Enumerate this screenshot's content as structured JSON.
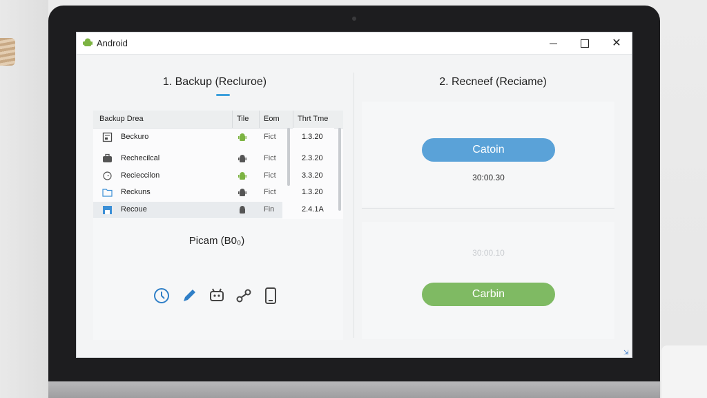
{
  "window": {
    "title": "Android",
    "app_icon": "android-icon",
    "accent": "#3ea0dc"
  },
  "left": {
    "heading": "1. Backup (Recluroe)",
    "table": {
      "columns": [
        "Backup Drea",
        "Tile",
        "Eom",
        "Thrt Tme"
      ],
      "rows": [
        {
          "icon": "backup-file-icon",
          "name": "Beckuro",
          "type_icon": "android-icon",
          "tag": "Fict",
          "time": "1.3.20",
          "selected": false
        },
        {
          "icon": "briefcase-icon",
          "name": "Rechecilcal",
          "type_icon": "android-icon",
          "tag": "Fict",
          "time": "2.3.20",
          "selected": false
        },
        {
          "icon": "clock-icon",
          "name": "Recieccilon",
          "type_icon": "android-icon",
          "tag": "Fict",
          "time": "3.3.20",
          "selected": false
        },
        {
          "icon": "folder-icon",
          "name": "Reckuns",
          "type_icon": "android-icon",
          "tag": "Fict",
          "time": "1.3.20",
          "selected": false
        },
        {
          "icon": "save-icon",
          "name": "Recoue",
          "type_icon": "android-icon",
          "tag": "Fin",
          "time": "2.4.1A",
          "selected": true
        }
      ]
    },
    "status": "Picam (B0₀)",
    "tools": [
      "clock-icon",
      "pencil-icon",
      "robot-icon",
      "share-icon",
      "phone-icon"
    ]
  },
  "right": {
    "heading": "2. Recneef (Reciame)",
    "primary_button": "Catoin",
    "primary_timer": "30:00.30",
    "secondary_timer": "30:00.10",
    "secondary_button": "Carbin",
    "colors": {
      "blue": "#5aa2d8",
      "green": "#7fba63"
    }
  }
}
